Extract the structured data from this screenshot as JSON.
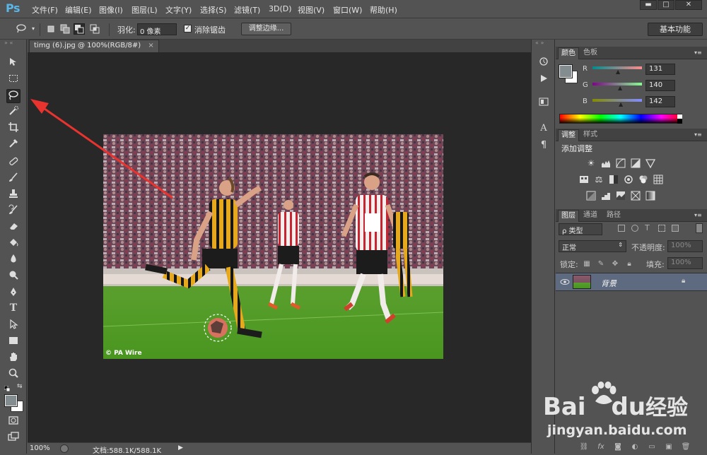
{
  "app": {
    "logo": "Ps"
  },
  "menu": [
    "文件(F)",
    "编辑(E)",
    "图像(I)",
    "图层(L)",
    "文字(Y)",
    "选择(S)",
    "滤镜(T)",
    "3D(D)",
    "视图(V)",
    "窗口(W)",
    "帮助(H)"
  ],
  "window_controls": {
    "minimize": "▬",
    "maximize": "□",
    "close": "✕"
  },
  "options": {
    "feather_label": "羽化:",
    "feather_value": "0 像素",
    "antialias_checked": "✓",
    "antialias_label": "消除锯齿",
    "refine_edge": "调整边缘...",
    "workspace": "基本功能"
  },
  "document": {
    "tab_title": "timg (6).jpg @ 100%(RGB/8#)",
    "tab_close": "×",
    "watermark": "© PA Wire",
    "zoom": "100%",
    "doc_info": "文档:588.1K/588.1K"
  },
  "panels": {
    "color_tabs": [
      "颜色",
      "色板"
    ],
    "channels": [
      {
        "label": "R",
        "value": "131",
        "gradient": "linear-gradient(90deg,#008c8e,#ff8c8e)"
      },
      {
        "label": "G",
        "value": "140",
        "gradient": "linear-gradient(90deg,#8300 8e,#83ff8e)"
      },
      {
        "label": "B",
        "value": "142",
        "gradient": "linear-gradient(90deg,#838c00,#838cff)"
      }
    ],
    "foreground_color": "#838c8e",
    "background_color": "#ffffff",
    "adjust_tabs": [
      "调整",
      "样式"
    ],
    "add_adjustment": "添加调整",
    "layers_tabs": [
      "图层",
      "通道",
      "路径"
    ],
    "kind_filter": "ρ 类型",
    "blend_mode": "正常",
    "opacity_label": "不透明度:",
    "opacity_value": "100%",
    "lock_label": "锁定:",
    "fill_label": "填充:",
    "fill_value": "100%",
    "layer_name": "背景"
  },
  "watermark_site": "jingyan.baidu.com",
  "watermark_brand": "Bai",
  "watermark_brand2": "du",
  "watermark_cn": "经验"
}
